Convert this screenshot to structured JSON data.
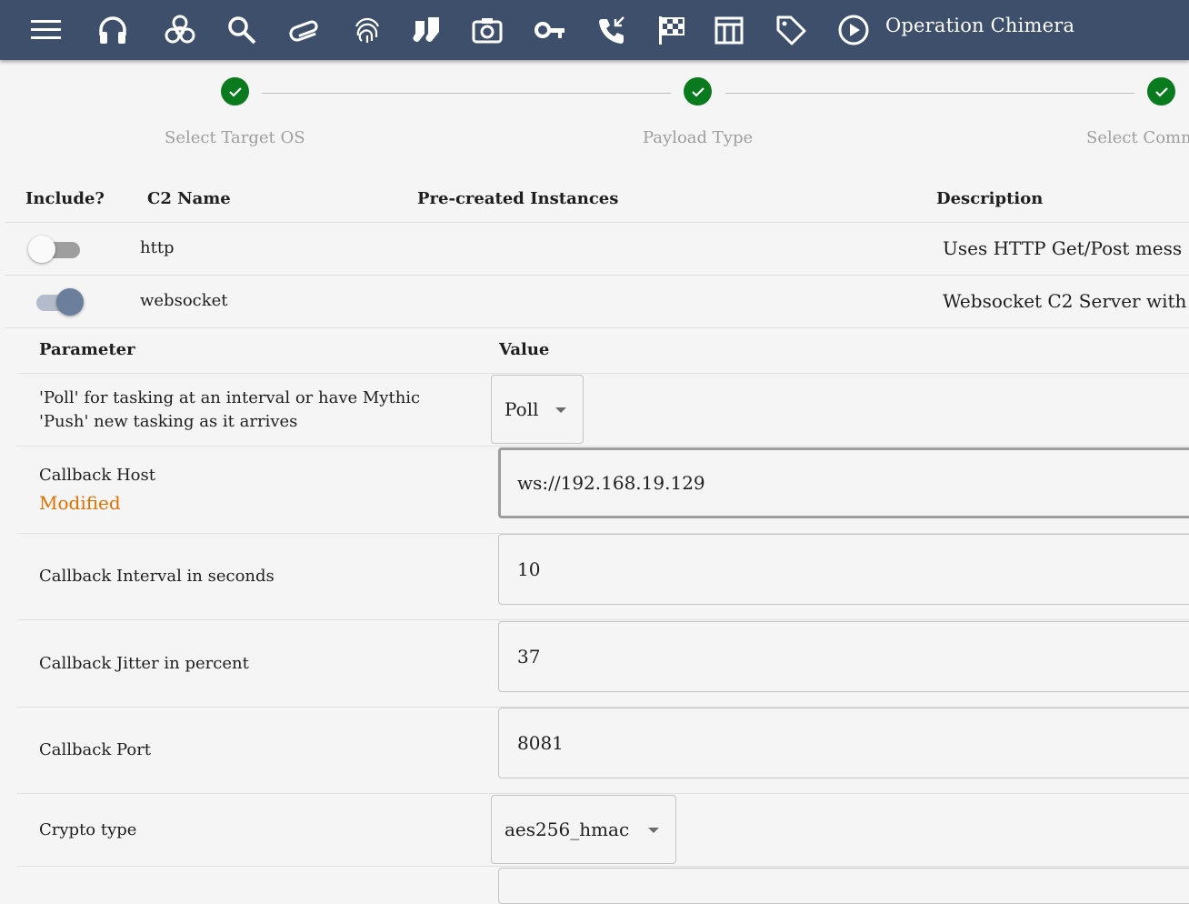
{
  "appbar": {
    "operation_name": "Operation Chimera",
    "icons": [
      "menu-icon",
      "headphones-icon",
      "biohazard-icon",
      "search-icon",
      "paperclip-icon",
      "fingerprint-icon",
      "socks-icon",
      "camera-icon",
      "key-icon",
      "phone-callback-icon",
      "checkered-flag-icon",
      "table-icon",
      "tag-icon",
      "play-circle-icon"
    ]
  },
  "stepper": {
    "steps": [
      {
        "label": "Select Target OS",
        "status": "complete"
      },
      {
        "label": "Payload Type",
        "status": "complete"
      },
      {
        "label": "Select Comm",
        "status": "complete"
      }
    ]
  },
  "c2_table": {
    "headers": {
      "include": "Include?",
      "name": "C2 Name",
      "instances": "Pre-created Instances",
      "description": "Description"
    },
    "rows": [
      {
        "included": false,
        "name": "http",
        "description": "Uses HTTP Get/Post mess"
      },
      {
        "included": true,
        "name": "websocket",
        "description": "Websocket C2 Server with"
      }
    ]
  },
  "params_table": {
    "headers": {
      "parameter": "Parameter",
      "value": "Value"
    },
    "rows": [
      {
        "label": "'Poll' for tasking at an interval or have Mythic 'Push' new tasking as it arrives",
        "type": "select",
        "value": "Poll"
      },
      {
        "label": "Callback Host",
        "modified": "Modified",
        "type": "text",
        "value": "ws://192.168.19.129"
      },
      {
        "label": "Callback Interval in seconds",
        "type": "text",
        "value": "10"
      },
      {
        "label": "Callback Jitter in percent",
        "type": "text",
        "value": "37"
      },
      {
        "label": "Callback Port",
        "type": "text",
        "value": "8081"
      },
      {
        "label": "Crypto type",
        "type": "select",
        "value": "aes256_hmac"
      }
    ]
  },
  "colors": {
    "appbar": "#3d4f6b",
    "step_complete": "#0a7a1e",
    "modified": "#e07000",
    "switch_on": "#6b7e9c"
  }
}
